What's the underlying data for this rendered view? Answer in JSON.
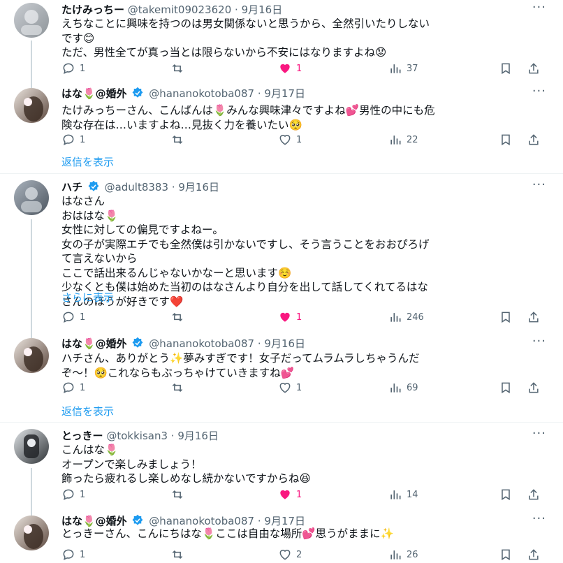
{
  "tweets": [
    {
      "name": "たけみっちー",
      "handle": "@takemit09023620",
      "date": "9月16日",
      "lines": [
        "えちなことに興味を持つのは男女関係ないと思うから、全然引いたりしない",
        "です😊",
        "ただ、男性全てが真っ当とは限らないから不安にはなりますよね😟"
      ],
      "replies": "1",
      "retweets": "",
      "likes": "1",
      "views": "37"
    },
    {
      "name": "はな🌷@婚外",
      "handle": "@hananokotoba087",
      "date": "9月17日",
      "lines": [
        "たけみっちーさん、こんばんは🌷みんな興味津々ですよね💕男性の中にも危",
        "険な存在は…いますよね…見抜く力を養いたい🥺"
      ],
      "replies": "1",
      "retweets": "",
      "likes": "1",
      "views": "22",
      "show_replies": "返信を表示"
    },
    {
      "name": "ハチ",
      "handle": "@adult8383",
      "date": "9月16日",
      "lines": [
        "はなさん",
        "おははな🌷",
        "女性に対しての偏見ですよねー。",
        "女の子が実際エチでも全然僕は引かないですし、そう言うことをおおぴろげ",
        "て言えないから",
        "ここで話出来るんじゃないかなーと思います☺️",
        "少なくとも僕は始めた当初のはなさんより自分を出して話してくれてるはな",
        "さんのほうが好きです❤️"
      ],
      "show_more": "さらに表示",
      "replies": "1",
      "retweets": "",
      "likes": "1",
      "views": "246"
    },
    {
      "name": "はな🌷@婚外",
      "handle": "@hananokotoba087",
      "date": "9月16日",
      "lines": [
        "ハチさん、ありがとう✨夢みすぎです！女子だってムラムラしちゃうんだ",
        "ぞ〜！🥺これならもぶっちゃけていきますね💕"
      ],
      "replies": "1",
      "retweets": "",
      "likes": "1",
      "views": "69",
      "show_replies": "返信を表示"
    },
    {
      "name": "とっきー",
      "handle": "@tokkisan3",
      "date": "9月16日",
      "lines": [
        "こんはな🌷",
        "オープンで楽しみましょう！",
        "飾ったら疲れるし楽しめなし続かないですからね😆"
      ],
      "replies": "1",
      "retweets": "",
      "likes": "1",
      "views": "14"
    },
    {
      "name": "はな🌷@婚外",
      "handle": "@hananokotoba087",
      "date": "9月17日",
      "lines": [
        "とっきーさん、こんにちはな🌷ここは自由な場所💕思うがままに✨"
      ],
      "replies": "1",
      "retweets": "",
      "likes": "2",
      "views": "26"
    }
  ],
  "colors": {
    "accent": "#1d9bf0",
    "like": "#f91880",
    "muted": "#536471"
  }
}
